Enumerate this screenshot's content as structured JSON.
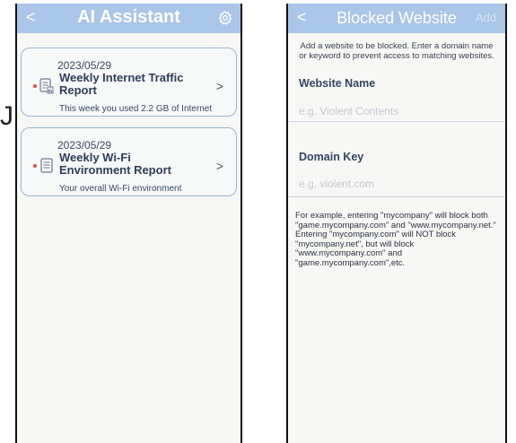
{
  "edge_glyph": "J",
  "left_screen": {
    "title": "AI Assistant",
    "back_icon": "chevron-left-icon",
    "settings_icon": "gear-icon",
    "cards": [
      {
        "date": "2023/05/29",
        "title": "Weekly Internet Traffic Report",
        "preview": "This week you used 2.2 GB of Internet",
        "icon": "report-icon",
        "unread_color": "#e44b4b"
      },
      {
        "date": "2023/05/29",
        "title": "Weekly Wi-Fi Environment Report",
        "preview": "Your overall Wi-Fi environment",
        "icon": "document-icon",
        "unread_color": "#e44b4b"
      }
    ]
  },
  "right_screen": {
    "title": "Blocked Website",
    "add_label": "Add",
    "hint": "Add a website to be blocked. Enter a domain name or keyword to prevent access to matching websites.",
    "website_name": {
      "label": "Website Name",
      "placeholder": "e.g. Violent Contents",
      "value": ""
    },
    "domain_key": {
      "label": "Domain Key",
      "placeholder": "e.g. violent.com",
      "value": ""
    },
    "example": "For example, entering \"mycompany\" will block both \"game.mycompany.com\" and \"www.mycompany.net.\" Entering \"mycompany.com\" will NOT block \"mycompany.net\", but will block \"www.mycompany.com\" and \"game.mycompany.com\",etc."
  },
  "colors": {
    "header": "#a9c6e8",
    "card_border": "#9bb6d3",
    "unread_dot": "#e44b4b",
    "background": "#f7f7f5"
  }
}
